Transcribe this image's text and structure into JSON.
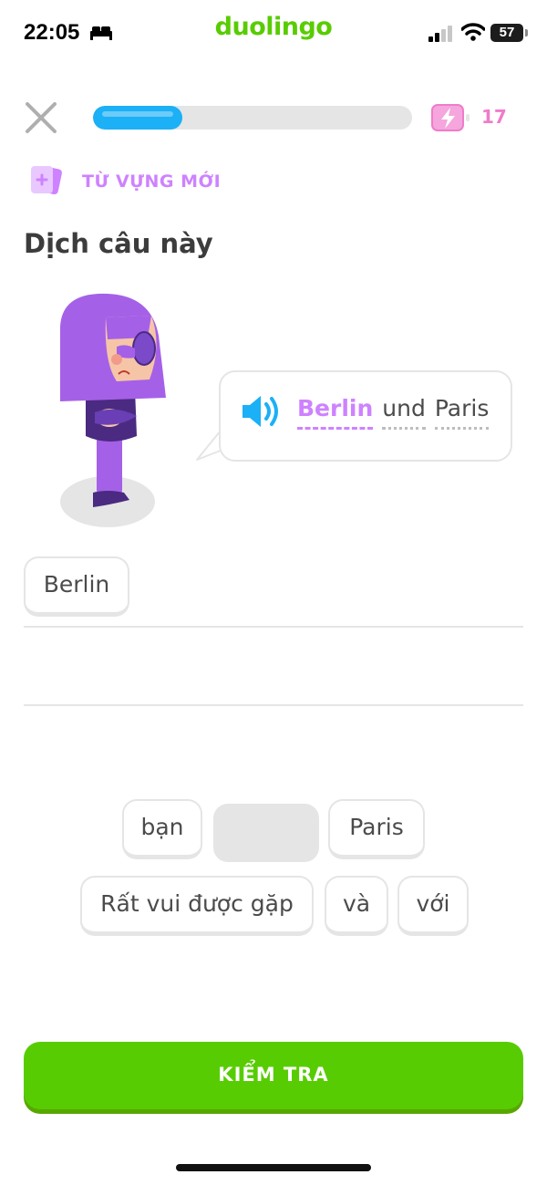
{
  "status_bar": {
    "time": "22:05",
    "app_name": "duolingo",
    "battery": "57",
    "icons": [
      "bed-icon",
      "signal-icon",
      "wifi-icon",
      "battery-icon"
    ]
  },
  "lesson": {
    "progress_fraction": 0.28,
    "energy_count": "17",
    "badge_label": "TỪ VỰNG MỚI",
    "prompt": "Dịch câu này",
    "sentence": {
      "highlighted_word": "Berlin",
      "words": [
        "und",
        "Paris"
      ]
    },
    "selected_answer": [
      "Berlin"
    ],
    "word_bank_row1": [
      "bạn",
      "",
      "Paris"
    ],
    "word_bank_row2": [
      "Rất vui được gặp",
      "và",
      "với"
    ],
    "check_button": "KIỂM TRA"
  },
  "colors": {
    "brand_green": "#58cc02",
    "progress_blue": "#1cb0f6",
    "new_word_purple": "#ce82ff",
    "energy_pink": "#ef7ccb"
  }
}
